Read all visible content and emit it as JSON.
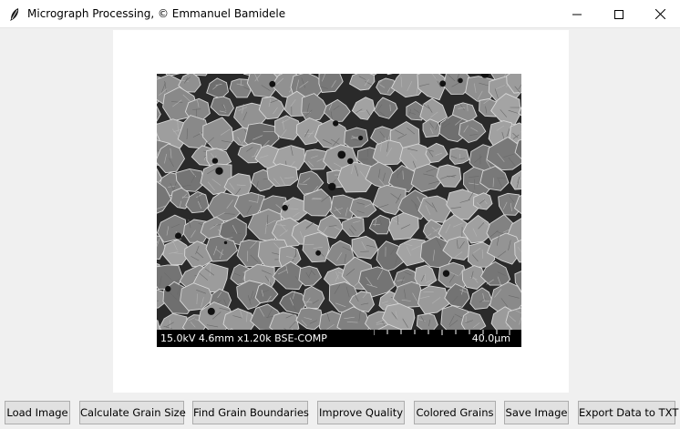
{
  "window": {
    "title": "Micrograph Processing,  © Emmanuel Bamidele",
    "app_icon": "feather-icon",
    "controls": [
      "minimize-icon",
      "maximize-icon",
      "close-icon"
    ]
  },
  "micrograph": {
    "icon": "sem-micrograph-image",
    "databar": {
      "parameters": "15.0kV 4.6mm x1.20k BSE-COMP",
      "scale": "40.0µm"
    }
  },
  "buttons": {
    "load_image": "Load Image",
    "calculate_grain_size": "Calculate Grain Size",
    "find_grain_boundaries": "Find Grain Boundaries",
    "improve_quality": "Improve Quality",
    "colored_grains": "Colored Grains",
    "save_image": "Save Image",
    "export_data": "Export Data to TXT"
  },
  "colors": {
    "window_bg": "#f0f0f0",
    "canvas_bg": "#ffffff",
    "button_bg": "#e1e1e1",
    "button_border": "#adadad"
  }
}
